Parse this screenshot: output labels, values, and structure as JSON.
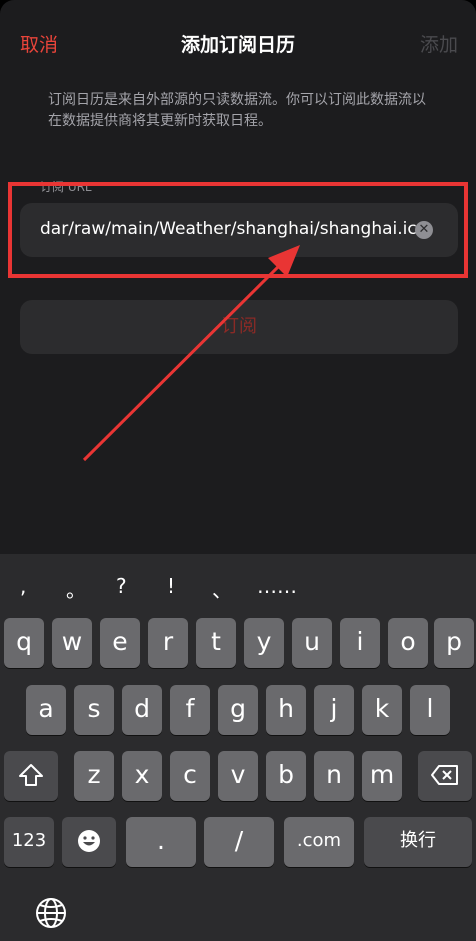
{
  "navbar": {
    "cancel": "取消",
    "title": "添加订阅日历",
    "add": "添加"
  },
  "description": "订阅日历是来自外部源的只读数据流。你可以订阅此数据流以在数据提供商将其更新时获取日程。",
  "url_field": {
    "label": "订阅 URL",
    "value": "dar/raw/main/Weather/shanghai/shanghai.ics",
    "clear_icon": "clear-icon"
  },
  "subscribe_button": "订阅",
  "annotation": {
    "highlight_color": "#e93534"
  },
  "keyboard": {
    "suggestions": [
      ",",
      "。",
      "?",
      "!",
      "、",
      "……"
    ],
    "row1": [
      "q",
      "w",
      "e",
      "r",
      "t",
      "y",
      "u",
      "i",
      "o",
      "p"
    ],
    "row2": [
      "a",
      "s",
      "d",
      "f",
      "g",
      "h",
      "j",
      "k",
      "l"
    ],
    "row3": [
      "z",
      "x",
      "c",
      "v",
      "b",
      "n",
      "m"
    ],
    "numbers_key": "123",
    "period_key": ".",
    "slash_key": "/",
    "dotcom_key": ".com",
    "return_key": "换行",
    "icons": [
      "shift-icon",
      "backspace-icon",
      "emoji-icon",
      "globe-icon"
    ]
  }
}
